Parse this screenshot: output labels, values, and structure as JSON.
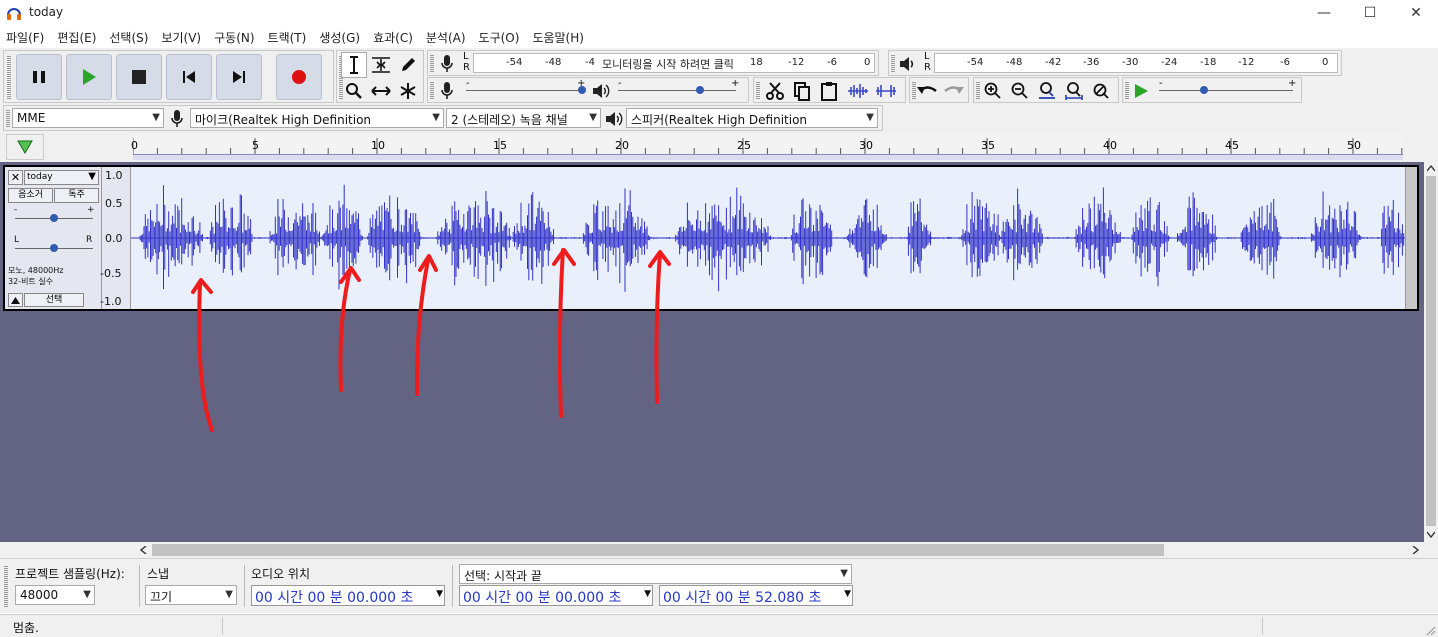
{
  "window": {
    "title": "today",
    "minimize": "—",
    "maximize": "☐",
    "close": "✕"
  },
  "menu": [
    "파일(F)",
    "편집(E)",
    "선택(S)",
    "보기(V)",
    "구동(N)",
    "트랙(T)",
    "생성(G)",
    "효과(C)",
    "분석(A)",
    "도구(O)",
    "도움말(H)"
  ],
  "meters": {
    "record_ticks": [
      "-54",
      "-48",
      "-4",
      "18",
      "-12",
      "-6",
      "0"
    ],
    "record_hint": "모니터링을 시작 하려면 클릭",
    "playback_ticks": [
      "-54",
      "-48",
      "-42",
      "-36",
      "-30",
      "-24",
      "-18",
      "-12",
      "-6",
      "0"
    ],
    "lr_l": "L",
    "lr_r": "R"
  },
  "devices": {
    "host": "MME",
    "input": "마이크(Realtek High Definition",
    "channels": "2 (스테레오) 녹음 채널",
    "output": "스피커(Realtek High Definition"
  },
  "ruler": {
    "ticks": [
      "0",
      "5",
      "10",
      "15",
      "20",
      "25",
      "30",
      "35",
      "40",
      "45",
      "50"
    ]
  },
  "track": {
    "name": "today",
    "mute": "음소거",
    "solo": "독주",
    "gain_minus": "-",
    "gain_plus": "+",
    "pan_l": "L",
    "pan_r": "R",
    "info1": "모노, 48000Hz",
    "info2": "32-비트 실수",
    "select": "선택",
    "scale": [
      "1.0",
      "0.5",
      "0.0",
      "-0.5",
      "-1.0"
    ]
  },
  "selection": {
    "rate_label": "프로젝트 샘플링(Hz):",
    "rate_value": "48000",
    "snap_label": "스냅",
    "snap_value": "끄기",
    "audio_pos_label": "오디오 위치",
    "audio_pos_value": "00 시간 00 분 00.000 초",
    "sel_label": "선택: 시작과 끝",
    "sel_start": "00 시간 00 분 00.000 초",
    "sel_end": "00 시간 00 분 52.080 초"
  },
  "status": {
    "text": "멈춤."
  },
  "colors": {
    "waveform": "#3232c8",
    "arrows": "#ee1c1c",
    "record": "#dd1111",
    "play": "#2aa52a",
    "timecode": "#2437c8"
  }
}
